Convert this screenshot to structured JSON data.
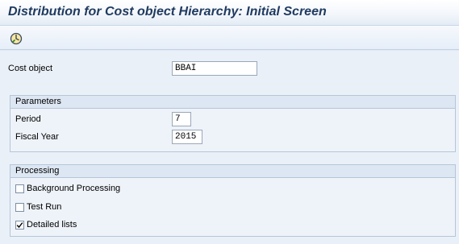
{
  "window": {
    "title": "Distribution for Cost object Hierarchy: Initial Screen"
  },
  "toolbar": {
    "execute_icon": "execute-clock-icon"
  },
  "main": {
    "cost_object": {
      "label": "Cost object",
      "value": "BBAI"
    },
    "parameters": {
      "header": "Parameters",
      "period": {
        "label": "Period",
        "value": "7"
      },
      "fiscal_year": {
        "label": "Fiscal Year",
        "value": "2015"
      }
    },
    "processing": {
      "header": "Processing",
      "background_processing": {
        "label": "Background Processing",
        "checked": false
      },
      "test_run": {
        "label": "Test Run",
        "checked": false
      },
      "detailed_lists": {
        "label": "Detailed lists",
        "checked": true
      }
    }
  },
  "colors": {
    "title": "#1f3a5f",
    "background": "#eaf0f8",
    "group_header": "#dde7f3"
  }
}
